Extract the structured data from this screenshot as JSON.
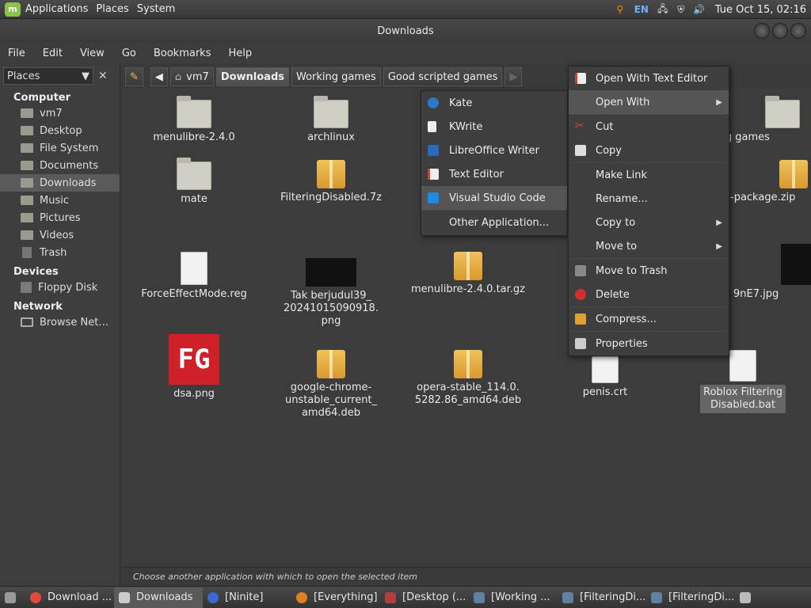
{
  "topbar": {
    "menus": [
      "Applications",
      "Places",
      "System"
    ],
    "keyboard": "EN",
    "clock": "Tue Oct 15, 02:16"
  },
  "window": {
    "title": "Downloads"
  },
  "menubar": [
    "File",
    "Edit",
    "View",
    "Go",
    "Bookmarks",
    "Help"
  ],
  "sidebar": {
    "combo": "Places",
    "sections": [
      {
        "title": "Computer",
        "items": [
          "vm7",
          "Desktop",
          "File System",
          "Documents",
          "Downloads",
          "Music",
          "Pictures",
          "Videos",
          "Trash"
        ]
      },
      {
        "title": "Devices",
        "items": [
          "Floppy Disk"
        ]
      },
      {
        "title": "Network",
        "items": [
          "Browse Net…"
        ]
      }
    ]
  },
  "pathbar": [
    "vm7",
    "Downloads",
    "Working games",
    "Good scripted games"
  ],
  "files": [
    {
      "name": "menulibre-2.4.0"
    },
    {
      "name": "archlinux"
    },
    {
      "name": "ing games"
    },
    {
      "name": "mate"
    },
    {
      "name": "FilteringDisabled.7z"
    },
    {
      "name": "-package.zip"
    },
    {
      "name": "ForceEffectMode.reg"
    },
    {
      "name": "Tak berjudul39_\n20241015090918.\npng"
    },
    {
      "name": "menulibre-2.4.0.tar.gz"
    },
    {
      "name": "9nE7.jpg"
    },
    {
      "name": "dsa.png"
    },
    {
      "name": "google-chrome-\nunstable_current_\namd64.deb"
    },
    {
      "name": "opera-stable_114.0.\n5282.86_amd64.deb"
    },
    {
      "name": "penis.crt"
    },
    {
      "name": "Roblox Filtering\nDisabled.bat"
    }
  ],
  "fg_text": "FG",
  "status": "Choose another application with which to open the selected item",
  "context_menu": [
    "Open With Text Editor",
    "Open With",
    "Cut",
    "Copy",
    "Make Link",
    "Rename...",
    "Copy to",
    "Move to",
    "Move to Trash",
    "Delete",
    "Compress...",
    "Properties"
  ],
  "openwith_menu": [
    "Kate",
    "KWrite",
    "LibreOffice Writer",
    "Text Editor",
    "Visual Studio Code",
    "Other Application..."
  ],
  "taskbar": [
    "Download ...",
    "Downloads",
    "[Ninite]",
    "[Everything]",
    "[Desktop (...",
    "[Working ...",
    "[FilteringDi...",
    "[FilteringDi..."
  ]
}
